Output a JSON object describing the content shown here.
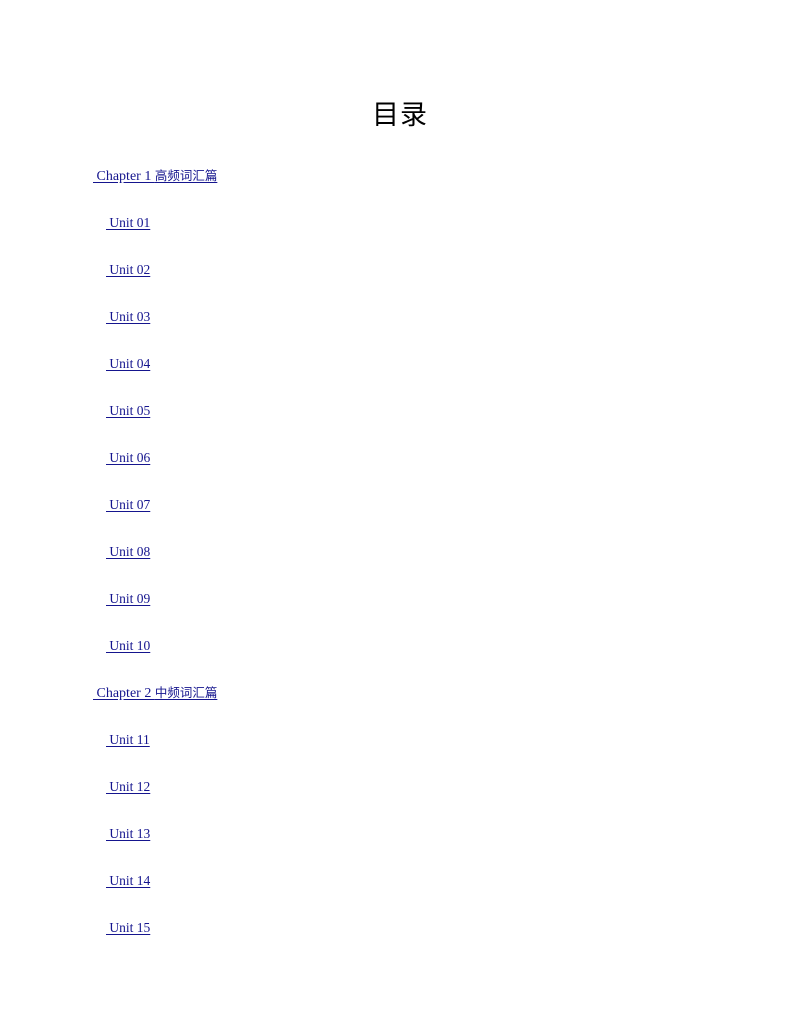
{
  "document": {
    "title": "目录",
    "background_color": "#ffffff",
    "link_color": "#15158e",
    "title_color": "#000000"
  },
  "toc": {
    "entries": [
      {
        "level": "chapter",
        "label": " Chapter 1 高频词汇篇",
        "latin": " Chapter 1 ",
        "cjk": "高频词汇篇"
      },
      {
        "level": "unit",
        "label": " Unit 01",
        "latin": " Unit 01",
        "cjk": ""
      },
      {
        "level": "unit",
        "label": " Unit 02",
        "latin": " Unit 02",
        "cjk": ""
      },
      {
        "level": "unit",
        "label": " Unit 03",
        "latin": " Unit 03",
        "cjk": ""
      },
      {
        "level": "unit",
        "label": " Unit 04",
        "latin": " Unit 04",
        "cjk": ""
      },
      {
        "level": "unit",
        "label": " Unit 05",
        "latin": " Unit 05",
        "cjk": ""
      },
      {
        "level": "unit",
        "label": " Unit 06",
        "latin": " Unit 06",
        "cjk": ""
      },
      {
        "level": "unit",
        "label": " Unit 07",
        "latin": " Unit 07",
        "cjk": ""
      },
      {
        "level": "unit",
        "label": " Unit 08",
        "latin": " Unit 08",
        "cjk": ""
      },
      {
        "level": "unit",
        "label": " Unit 09",
        "latin": " Unit 09",
        "cjk": ""
      },
      {
        "level": "unit",
        "label": " Unit 10",
        "latin": " Unit 10",
        "cjk": ""
      },
      {
        "level": "chapter",
        "label": " Chapter 2 中频词汇篇",
        "latin": " Chapter 2 ",
        "cjk": "中频词汇篇"
      },
      {
        "level": "unit",
        "label": " Unit 11",
        "latin": " Unit 11",
        "cjk": ""
      },
      {
        "level": "unit",
        "label": " Unit 12",
        "latin": " Unit 12",
        "cjk": ""
      },
      {
        "level": "unit",
        "label": " Unit 13",
        "latin": " Unit 13",
        "cjk": ""
      },
      {
        "level": "unit",
        "label": " Unit 14",
        "latin": " Unit 14",
        "cjk": ""
      },
      {
        "level": "unit",
        "label": " Unit 15",
        "latin": " Unit 15",
        "cjk": ""
      }
    ]
  }
}
